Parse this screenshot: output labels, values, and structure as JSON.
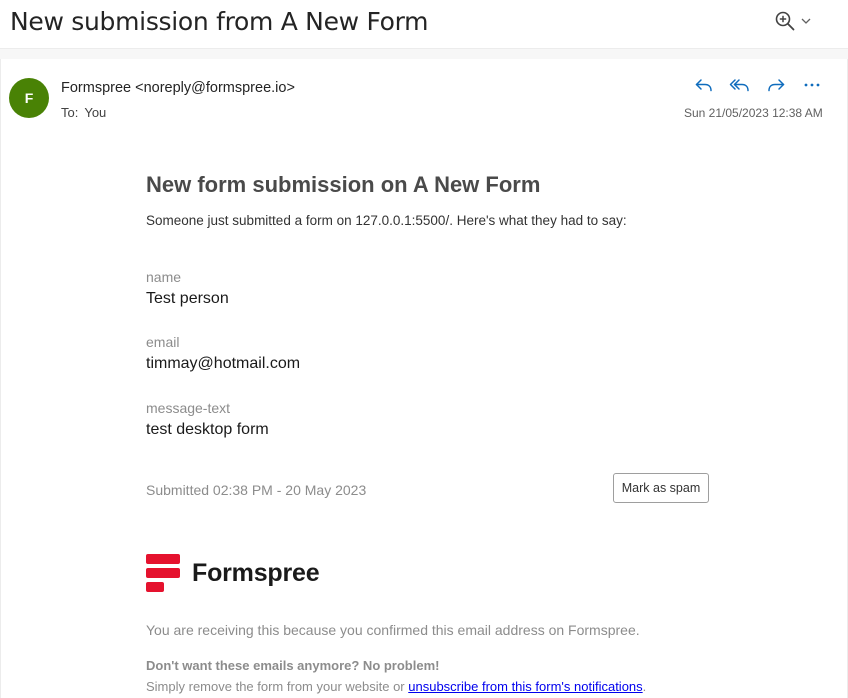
{
  "subject": "New submission from A New Form",
  "header": {
    "avatar_initial": "F",
    "avatar_color": "#498205",
    "sender": "Formspree <noreply@formspree.io>",
    "to_label": "To:",
    "to_value": "You",
    "date": "Sun 21/05/2023 12:38 AM",
    "actions": [
      "reply-icon",
      "reply-all-icon",
      "forward-icon",
      "more-icon"
    ],
    "accent_color": "#0f6cbd"
  },
  "body": {
    "title": "New form submission on A New Form",
    "intro": "Someone just submitted a form on 127.0.0.1:5500/. Here's what they had to say:",
    "fields": [
      {
        "label": "name",
        "value": "Test person"
      },
      {
        "label": "email",
        "value": "timmay@hotmail.com"
      },
      {
        "label": "message-text",
        "value": "test desktop form"
      }
    ],
    "submitted": "Submitted 02:38 PM - 20 May 2023",
    "spam_button": "Mark as spam",
    "logo_text": "Formspree",
    "logo_color": "#e5122e",
    "footer_line1": "You are receiving this because you confirmed this email address on Formspree.",
    "footer_line2": "Don't want these emails anymore? No problem!",
    "footer_line3_prefix": "Simply remove the form from your website or ",
    "footer_link": "unsubscribe from this form's notifications",
    "footer_line3_suffix": "."
  }
}
